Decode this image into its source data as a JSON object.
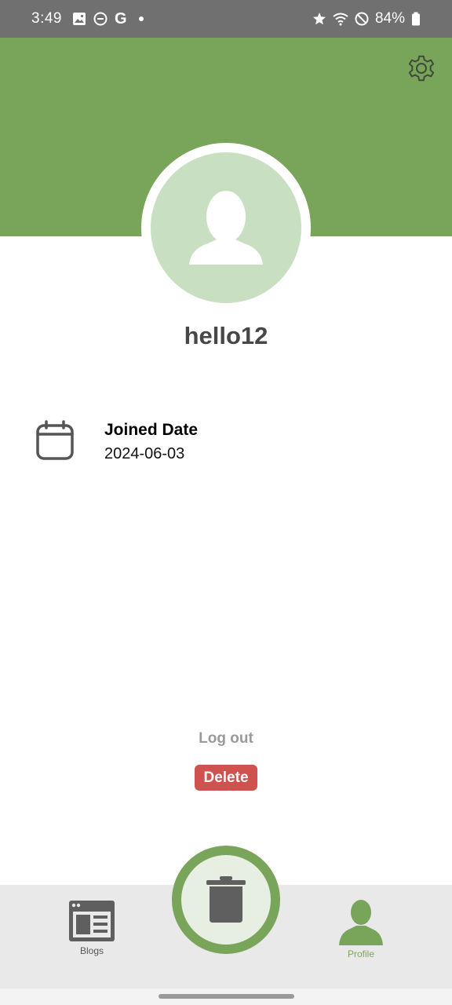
{
  "status_bar": {
    "time": "3:49",
    "battery": "84%",
    "left_icons": [
      "image-icon",
      "dnd-icon",
      "google-icon",
      "dot-icon"
    ],
    "right_icons": [
      "star-icon",
      "wifi-icon",
      "blocked-icon",
      "battery-icon"
    ]
  },
  "header": {
    "color": "#79a55a",
    "settings_icon": "gear-icon"
  },
  "profile": {
    "username": "hello12",
    "avatar_icon": "person-silhouette-icon"
  },
  "info": {
    "joined_label": "Joined Date",
    "joined_value": "2024-06-03",
    "icon": "calendar-icon"
  },
  "actions": {
    "logout_label": "Log out",
    "delete_label": "Delete",
    "delete_color": "#d0524f"
  },
  "bottom_nav": {
    "items": [
      {
        "label": "Blogs",
        "icon": "browser-window-icon"
      },
      {
        "label": "Profile",
        "icon": "person-icon",
        "active": true
      }
    ],
    "center_icon": "trash-icon",
    "accent": "#79a55a"
  }
}
